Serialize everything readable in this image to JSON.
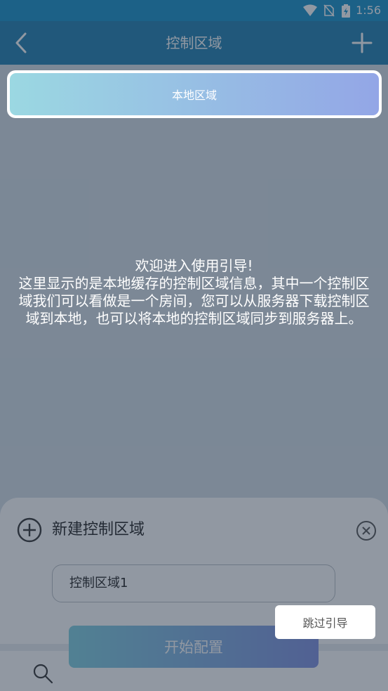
{
  "status_bar": {
    "time": "1:56",
    "icons": [
      "wifi-icon",
      "no-sim-icon",
      "battery-charging-icon"
    ]
  },
  "app_bar": {
    "title": "控制区域",
    "back_icon": "chevron-left-icon",
    "add_icon": "plus-icon"
  },
  "region_list": {
    "items": [
      {
        "label": "本地区域"
      }
    ]
  },
  "guide": {
    "text": "欢迎进入使用引导!\n这里显示的是本地缓存的控制区域信息，其中一个控制区域我们可以看做是一个房间，您可以从服务器下载控制区域到本地，也可以将本地的控制区域同步到服务器上。",
    "skip_label": "跳过引导"
  },
  "new_region_sheet": {
    "title": "新建控制区域",
    "name_value": "控制区域1",
    "start_label": "开始配置"
  },
  "colors": {
    "status_bar": "#1591c8",
    "app_bar": "#1e7fb0",
    "gradient_start": "#9bd8e2",
    "gradient_end": "#93a6e6"
  }
}
